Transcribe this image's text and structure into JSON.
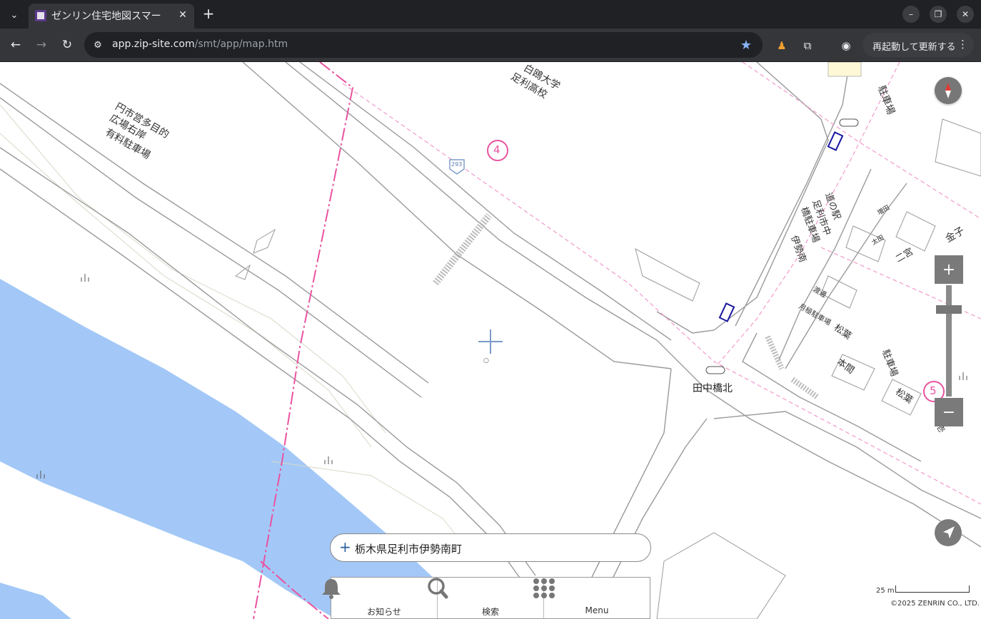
{
  "browser": {
    "tab_title": "ゼンリン住宅地図スマー",
    "url_host": "app.zip-site.com",
    "url_path": "/smt/app/map.htm",
    "update_button": "再起動して更新する"
  },
  "map": {
    "labels": {
      "university": "白鴎大学",
      "high_school": "足利高校",
      "parking_left_1": "円市営多目的",
      "parking_left_2": "広場右岸",
      "parking_left_3": "有料駐車場",
      "parking_top_right": "駐車場",
      "road_station": "道の駅",
      "city_parking_1": "足利市中",
      "city_parking_2": "橋駐車場",
      "city_parking_3": "伊勢南",
      "route_4": "4",
      "route_5": "5",
      "route_293": "293",
      "intersection": "田中橋北",
      "kaneko": "金子",
      "ninomiya": "二宮",
      "matsuba_1": "松葉",
      "matsuba_2": "松葉",
      "honma": "本間",
      "parking_center": "駐車場",
      "monthly_parking": "月極駐車場",
      "watanabe": "渡邊",
      "masuda": "増田",
      "ota": "太田",
      "ichi": "壱"
    },
    "colors": {
      "river": "#a3c8f7",
      "boundary": "#e9539f",
      "road": "#9a9a9a",
      "controls": "#7a7a7a"
    }
  },
  "controls": {
    "zoom_in": "+",
    "zoom_out": "−",
    "compass_icon": "compass-icon",
    "locate_icon": "navigation-arrow-icon"
  },
  "address": {
    "plus": "+",
    "text": "栃木県足利市伊勢南町"
  },
  "bottom_menu": {
    "items": [
      {
        "label": "お知らせ",
        "icon": "bell-icon"
      },
      {
        "label": "検索",
        "icon": "magnifier-icon"
      },
      {
        "label": "Menu",
        "icon": "grid-dots-icon"
      }
    ]
  },
  "scale": {
    "label": "25 m"
  },
  "copyright": "©2025 ZENRIN CO., LTD."
}
